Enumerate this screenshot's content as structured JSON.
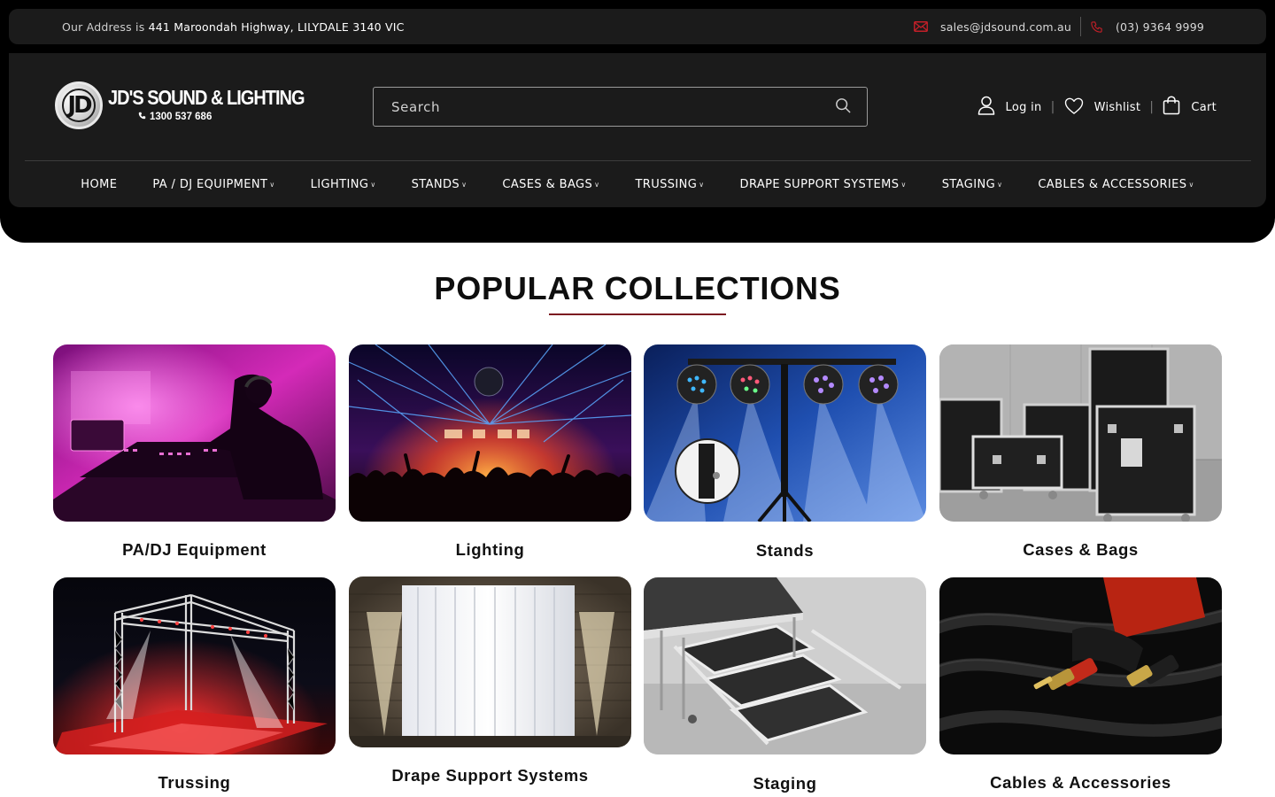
{
  "topbar": {
    "address_prefix": "Our Address is",
    "address_value": "441 Maroondah Highway, LILYDALE 3140 VIC",
    "email": "sales@jdsound.com.au",
    "phone": "(03) 9364 9999",
    "accent_color": "#c21f28"
  },
  "logo": {
    "badge": "JD",
    "name": "JD'S SOUND & LIGHTING",
    "phone": "1300 537 686"
  },
  "search": {
    "placeholder": "Search"
  },
  "actions": {
    "login": "Log in",
    "wishlist": "Wishlist",
    "cart": "Cart"
  },
  "nav": [
    "HOME",
    "PA / DJ EQUIPMENT",
    "LIGHTING",
    "STANDS",
    "CASES & BAGS",
    "TRUSSING",
    "DRAPE SUPPORT SYSTEMS",
    "STAGING",
    "CABLES & ACCESSORIES"
  ],
  "collections": {
    "title": "POPULAR COLLECTIONS",
    "accent_color": "#7b1820",
    "items": [
      {
        "label": "PA/DJ Equipment",
        "icon": "dj-mixer-image"
      },
      {
        "label": "Lighting",
        "icon": "concert-lights-image"
      },
      {
        "label": "Stands",
        "icon": "lighting-stand-image"
      },
      {
        "label": "Cases & Bags",
        "icon": "road-cases-image"
      },
      {
        "label": "Trussing",
        "icon": "truss-stage-image"
      },
      {
        "label": "Drape Support Systems",
        "icon": "white-drape-image"
      },
      {
        "label": "Staging",
        "icon": "stage-steps-image"
      },
      {
        "label": "Cables & Accessories",
        "icon": "rca-cable-image"
      }
    ]
  }
}
